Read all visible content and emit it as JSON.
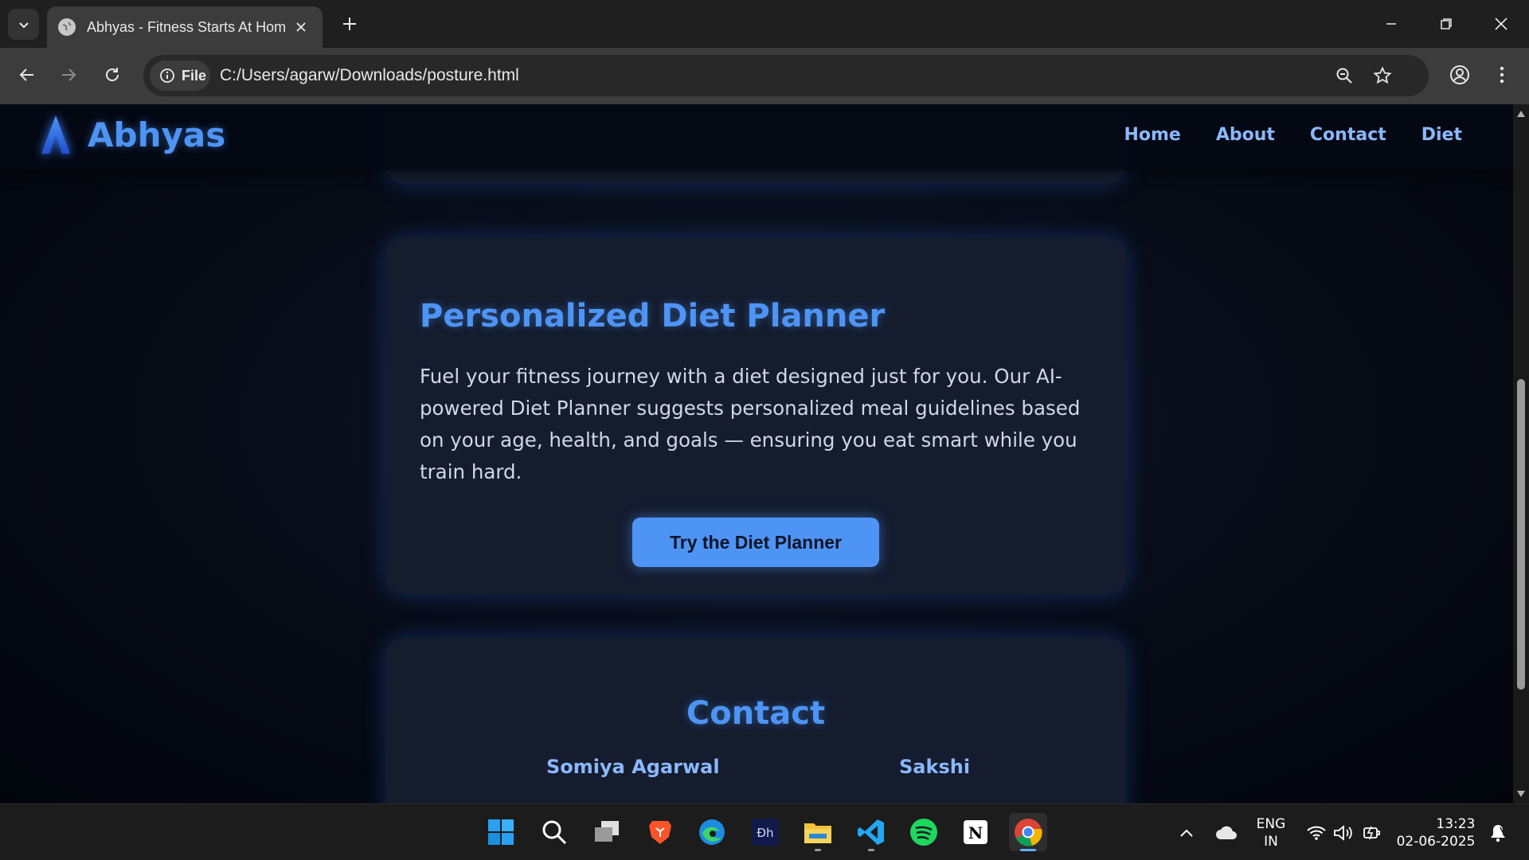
{
  "browser": {
    "tab_title": "Abhyas - Fitness Starts At Home",
    "site_chip_label": "File",
    "url": "C:/Users/agarw/Downloads/posture.html"
  },
  "site": {
    "brand": "Abhyas",
    "nav": [
      "Home",
      "About",
      "Contact",
      "Diet"
    ],
    "accent_color": "#4e94f5"
  },
  "diet_section": {
    "title": "Personalized Diet Planner",
    "description": "Fuel your fitness journey with a diet designed just for you. Our AI-powered Diet Planner suggests personalized meal guidelines based on your age, health, and goals — ensuring you eat smart while you train hard.",
    "button_label": "Try the Diet Planner"
  },
  "contact_section": {
    "title": "Contact",
    "names": [
      "Somiya Agarwal",
      "Sakshi"
    ]
  },
  "taskbar": {
    "apps": [
      "windows-start-icon",
      "search-icon",
      "task-view-icon",
      "brave-icon",
      "edge-icon",
      "app-dh-icon",
      "file-explorer-icon",
      "vscode-icon",
      "spotify-icon",
      "notion-icon",
      "chrome-icon"
    ],
    "lang_line1": "ENG",
    "lang_line2": "IN",
    "time": "13:23",
    "date": "02-06-2025"
  }
}
